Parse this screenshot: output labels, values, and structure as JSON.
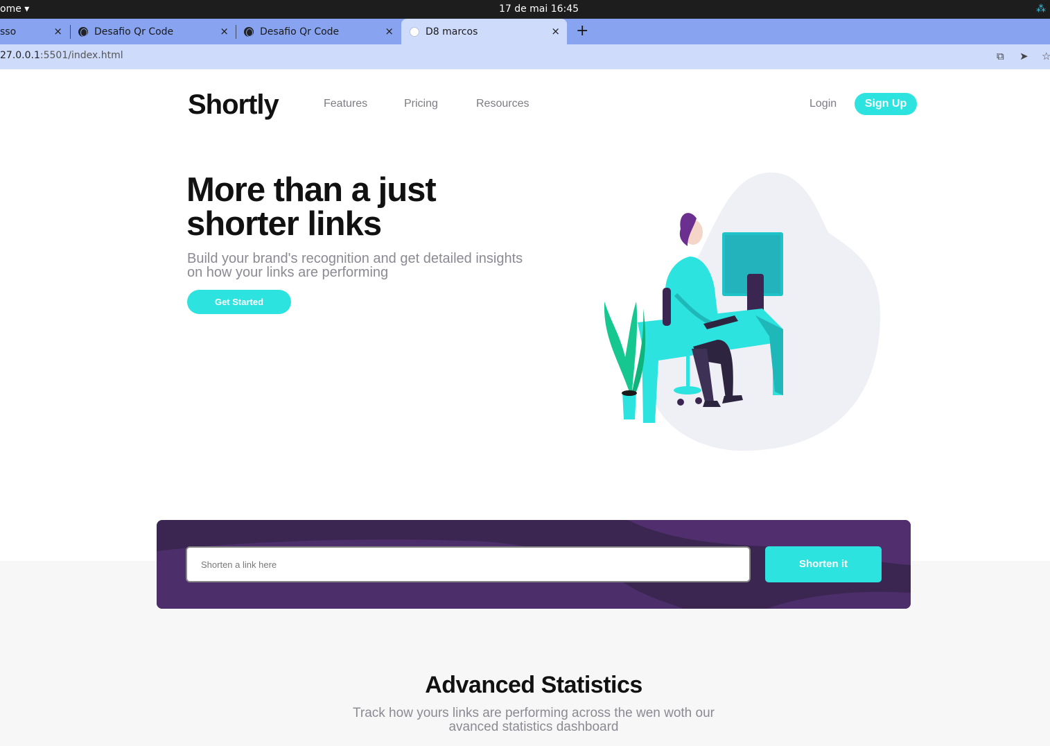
{
  "os": {
    "app_menu": "ome ▾",
    "clock": "17 de mai  16:45"
  },
  "browser": {
    "tabs": [
      {
        "label": "sso",
        "close": "×"
      },
      {
        "label": "Desafio Qr Code",
        "close": "×"
      },
      {
        "label": "Desafio Qr Code",
        "close": "×"
      },
      {
        "label": "D8 marcos",
        "close": "×"
      }
    ],
    "new_tab": "+",
    "url_host": "27.0.0.1",
    "url_rest": ":5501/index.html"
  },
  "site": {
    "logo": "Shortly",
    "nav": [
      "Features",
      "Pricing",
      "Resources"
    ],
    "login": "Login",
    "signup": "Sign Up",
    "hero": {
      "title": "More than a just shorter links",
      "subtitle": "Build your brand's recognition and get detailed insights on how your links are performing",
      "cta": "Get Started"
    },
    "shorten": {
      "placeholder": "Shorten a link here",
      "button": "Shorten it"
    },
    "stats": {
      "title": "Advanced Statistics",
      "subtitle": "Track how yours links are performing across the wen woth our avanced statistics dashboard"
    }
  },
  "colors": {
    "accent": "#2de3df",
    "panel": "#3b2651",
    "text_muted": "#8a8a93"
  }
}
